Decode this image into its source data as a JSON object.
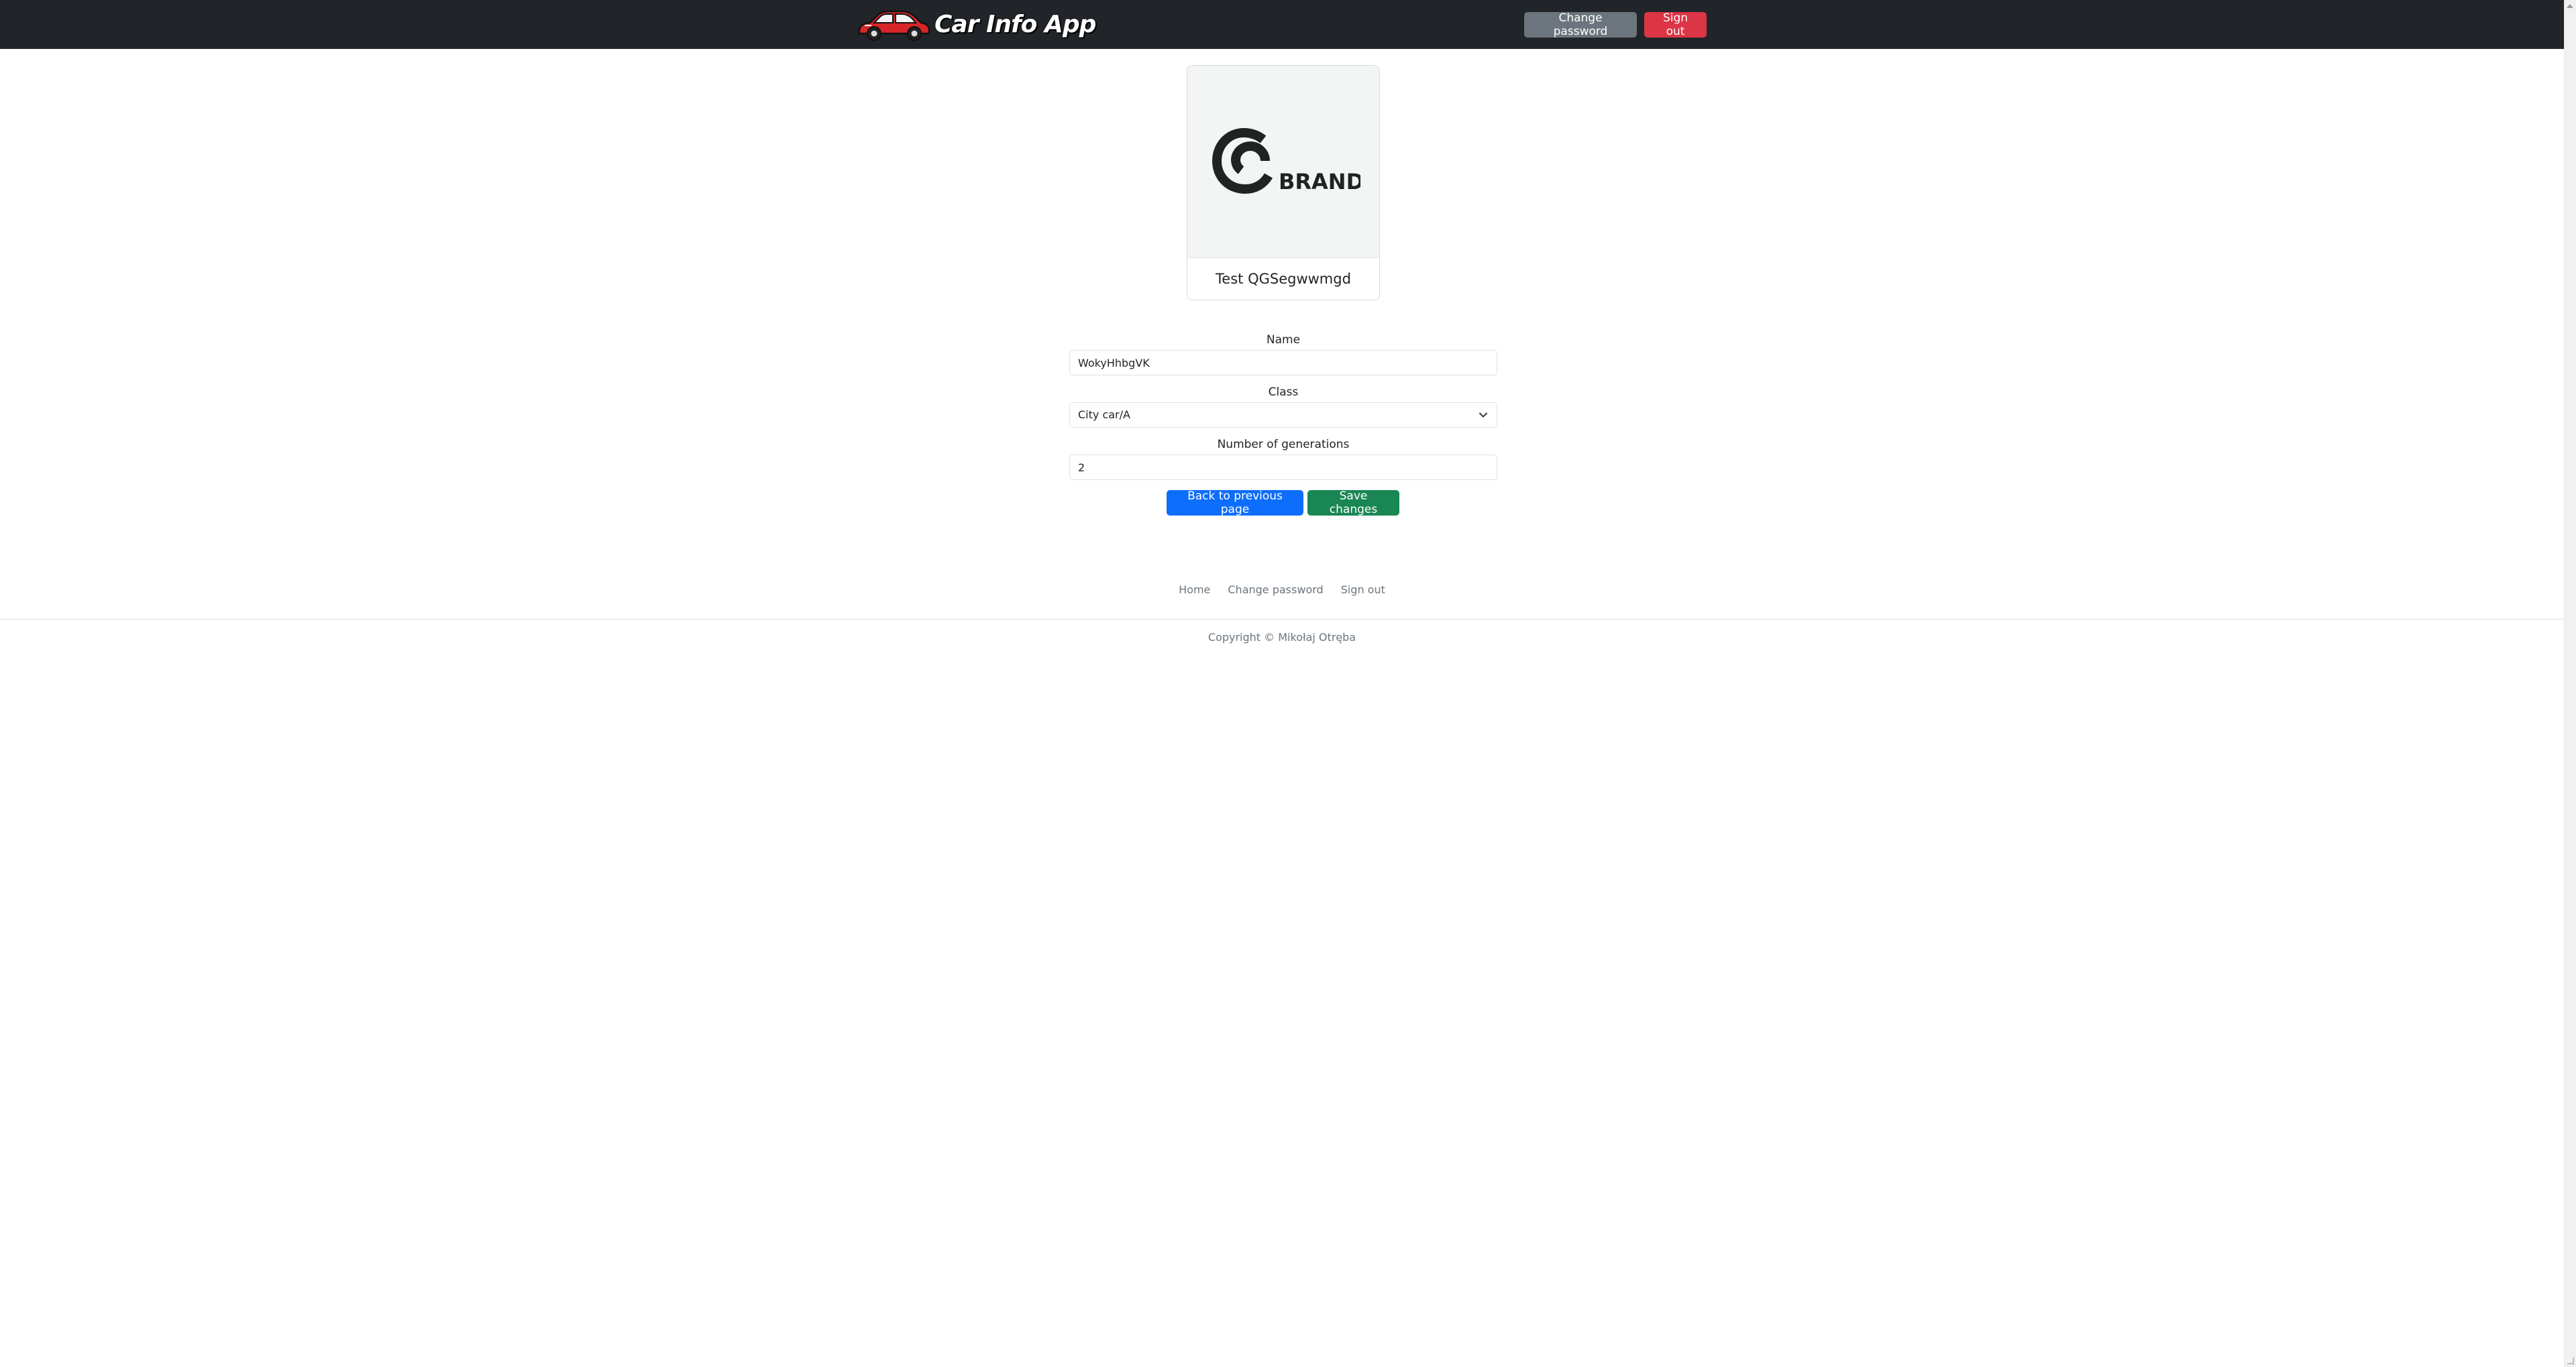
{
  "navbar": {
    "brand_text": "Car Info App",
    "change_password_label": "Change password",
    "sign_out_label": "Sign out"
  },
  "card": {
    "logo_text": "BRAND",
    "title": "Test QGSegwwmgd"
  },
  "form": {
    "name_label": "Name",
    "name_value": "WokyHhbgVK",
    "class_label": "Class",
    "class_value": "City car/A",
    "generations_label": "Number of generations",
    "generations_value": "2"
  },
  "actions": {
    "back_label": "Back to previous page",
    "save_label": "Save changes"
  },
  "footer": {
    "links": [
      "Home",
      "Change password",
      "Sign out"
    ],
    "copyright": "Copyright © Mikołaj Otręba"
  },
  "colors": {
    "navbar_bg": "#212529",
    "secondary": "#6c757d",
    "danger": "#dc3545",
    "primary": "#0d6efd",
    "success": "#198754"
  }
}
